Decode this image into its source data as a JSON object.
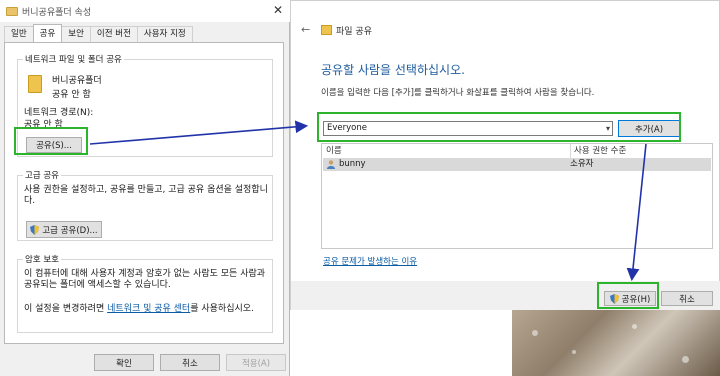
{
  "props_dialog": {
    "title": "버니공유폴더 속성",
    "tabs": [
      "일반",
      "공유",
      "보안",
      "이전 버전",
      "사용자 지정"
    ],
    "active_tab": "공유",
    "network_group": {
      "legend": "네트워크 파일 및 폴더 공유",
      "folder_name": "버니공유폴더",
      "share_status": "공유 안 함",
      "path_label": "네트워크 경로(N):",
      "path_value": "공유 안 함",
      "share_button": "공유(S)..."
    },
    "advanced_group": {
      "legend": "고급 공유",
      "desc": "사용 권한을 설정하고, 공유를 만들고, 고급 공유 옵션을 설정합니다.",
      "button": "고급 공유(D)..."
    },
    "password_group": {
      "legend": "암호 보호",
      "desc": "이 컴퓨터에 대해 사용자 계정과 암호가 없는 사람도 모든 사람과 공유되는 폴더에 액세스할 수 있습니다.",
      "change_prefix": "이 설정을 변경하려면 ",
      "change_link": "네트워크 및 공유 센터",
      "change_suffix": "를 사용하십시오."
    },
    "buttons": {
      "ok": "확인",
      "cancel": "취소",
      "apply": "적용(A)"
    }
  },
  "share_dialog": {
    "title": "파일 공유",
    "heading": "공유할 사람을 선택하십시오.",
    "description": "이름을 입력한 다음 [추가]를 클릭하거나 화살표를 클릭하여 사람을 찾습니다.",
    "input_value": "Everyone",
    "add_button": "추가(A)",
    "columns": [
      "이름",
      "사용 권한 수준"
    ],
    "rows": [
      {
        "name": "bunny",
        "level": "소유자"
      }
    ],
    "trouble_link": "공유 문제가 발생하는 이유",
    "share_button": "공유(H)",
    "cancel_button": "취소"
  },
  "colors": {
    "highlight": "#2cb52c",
    "arrow": "#2233aa",
    "heading": "#1c5b9e",
    "link": "#0b5ba5"
  }
}
